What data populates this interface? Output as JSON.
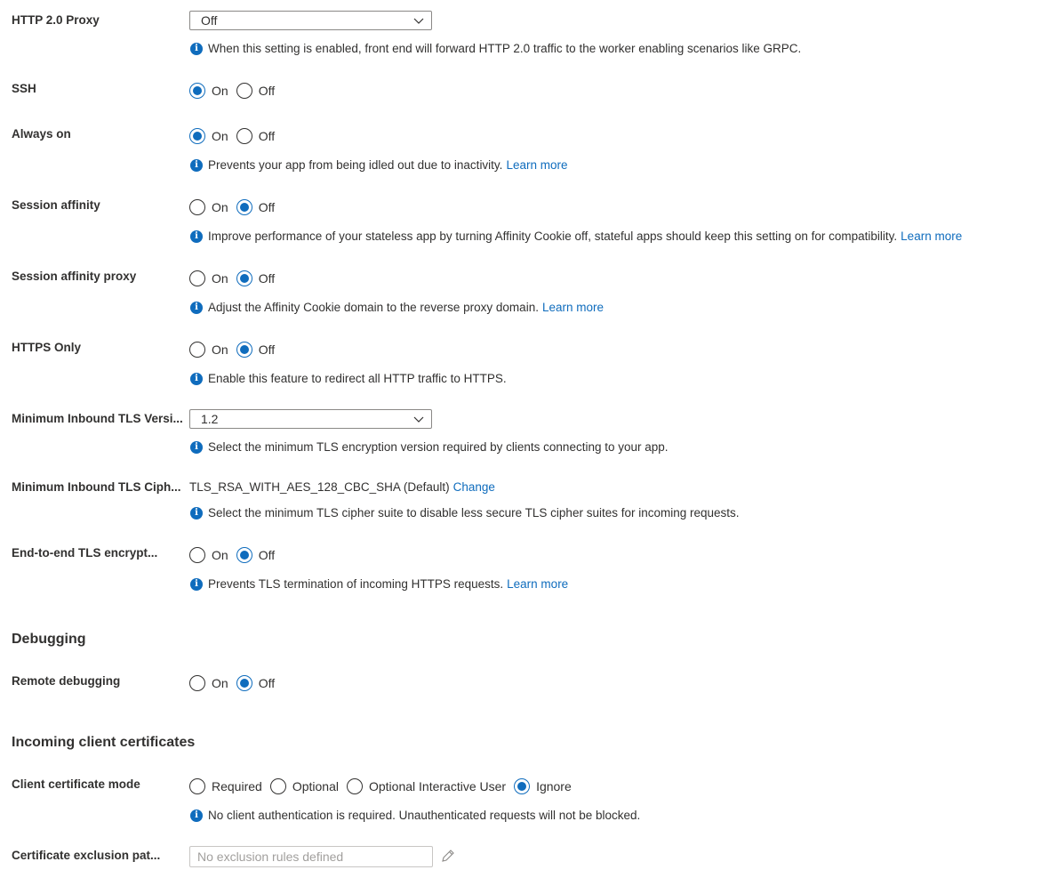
{
  "http2_proxy": {
    "label": "HTTP 2.0 Proxy",
    "value": "Off",
    "info": "When this setting is enabled, front end will forward HTTP 2.0 traffic to the worker enabling scenarios like GRPC."
  },
  "ssh": {
    "label": "SSH",
    "on": "On",
    "off": "Off",
    "selected": "On"
  },
  "always_on": {
    "label": "Always on",
    "on": "On",
    "off": "Off",
    "selected": "On",
    "info": "Prevents your app from being idled out due to inactivity.",
    "link": "Learn more"
  },
  "session_affinity": {
    "label": "Session affinity",
    "on": "On",
    "off": "Off",
    "selected": "Off",
    "info": "Improve performance of your stateless app by turning Affinity Cookie off, stateful apps should keep this setting on for compatibility.",
    "link": "Learn more"
  },
  "session_affinity_proxy": {
    "label": "Session affinity proxy",
    "on": "On",
    "off": "Off",
    "selected": "Off",
    "info": "Adjust the Affinity Cookie domain to the reverse proxy domain.",
    "link": "Learn more"
  },
  "https_only": {
    "label": "HTTPS Only",
    "on": "On",
    "off": "Off",
    "selected": "Off",
    "info": "Enable this feature to redirect all HTTP traffic to HTTPS."
  },
  "min_tls_version": {
    "label": "Minimum Inbound TLS Versi...",
    "value": "1.2",
    "info": "Select the minimum TLS encryption version required by clients connecting to your app."
  },
  "min_tls_cipher": {
    "label": "Minimum Inbound TLS Ciph...",
    "value": "TLS_RSA_WITH_AES_128_CBC_SHA (Default)",
    "link": "Change",
    "info": "Select the minimum TLS cipher suite to disable less secure TLS cipher suites for incoming requests."
  },
  "e2e_tls": {
    "label": "End-to-end TLS encrypt...",
    "on": "On",
    "off": "Off",
    "selected": "Off",
    "info": "Prevents TLS termination of incoming HTTPS requests.",
    "link": "Learn more"
  },
  "debugging": {
    "title": "Debugging",
    "remote_debugging": {
      "label": "Remote debugging",
      "on": "On",
      "off": "Off",
      "selected": "Off"
    }
  },
  "client_certs": {
    "title": "Incoming client certificates",
    "mode": {
      "label": "Client certificate mode",
      "options": [
        "Required",
        "Optional",
        "Optional Interactive User",
        "Ignore"
      ],
      "selected": "Ignore",
      "info": "No client authentication is required. Unauthenticated requests will not be blocked."
    },
    "exclusion": {
      "label": "Certificate exclusion pat...",
      "placeholder": "No exclusion rules defined"
    }
  },
  "colors": {
    "accent": "#0f6cbd",
    "text": "#323130",
    "border": "#8a8886"
  },
  "icons": {
    "info": "info-icon",
    "chevron": "chevron-down-icon",
    "edit": "pencil-icon"
  }
}
